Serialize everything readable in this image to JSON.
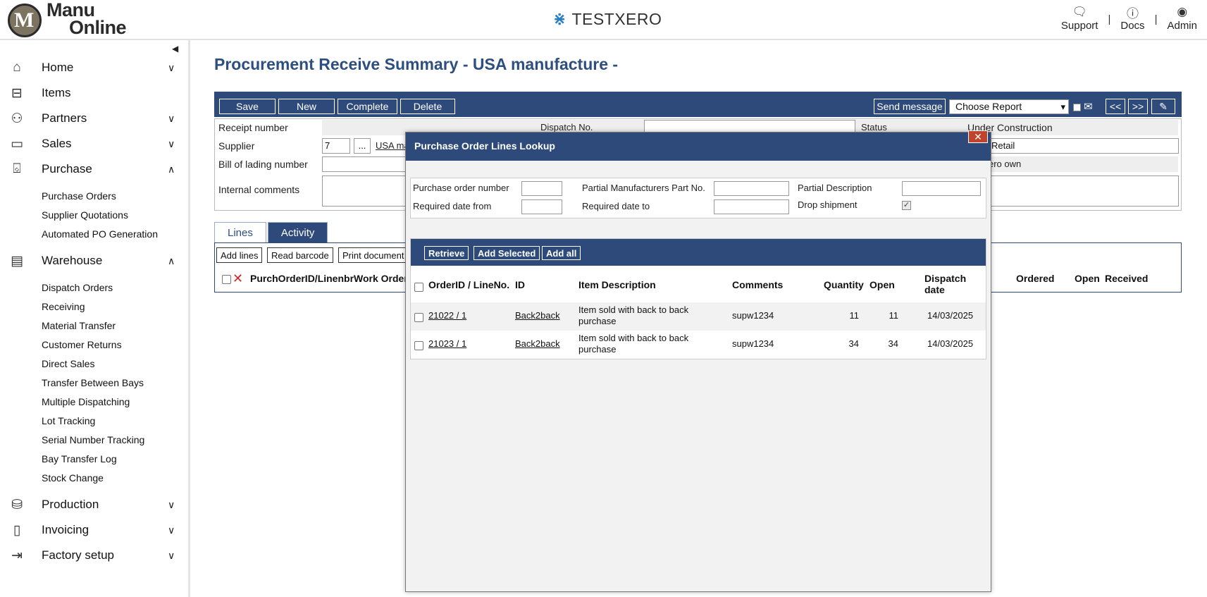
{
  "header": {
    "logo_line1": "Manu",
    "logo_line2": "Online",
    "brand": "TESTXERO",
    "links": [
      {
        "label": "Support",
        "icon": "chat-icon"
      },
      {
        "label": "Docs",
        "icon": "help-icon"
      },
      {
        "label": "Admin",
        "icon": "user-icon"
      }
    ],
    "separator": "|"
  },
  "sidebar": {
    "items": [
      {
        "label": "Home",
        "icon": "home-icon",
        "expanded": false
      },
      {
        "label": "Items",
        "icon": "items-icon"
      },
      {
        "label": "Partners",
        "icon": "partners-icon",
        "expanded": false
      },
      {
        "label": "Sales",
        "icon": "wallet-icon",
        "expanded": false
      },
      {
        "label": "Purchase",
        "icon": "basket-icon",
        "expanded": true
      },
      {
        "label": "Warehouse",
        "icon": "warehouse-icon",
        "expanded": true
      },
      {
        "label": "Production",
        "icon": "database-icon",
        "expanded": false
      },
      {
        "label": "Invoicing",
        "icon": "document-icon",
        "expanded": false
      },
      {
        "label": "Factory setup",
        "icon": "exit-icon",
        "expanded": false
      }
    ],
    "purchase_sub": [
      "Purchase Orders",
      "Supplier Quotations",
      "Automated PO Generation"
    ],
    "warehouse_sub": [
      "Dispatch Orders",
      "Receiving",
      "Material Transfer",
      "Customer Returns",
      "Direct Sales",
      "Transfer Between Bays",
      "Multiple Dispatching",
      "Lot Tracking",
      "Serial Number Tracking",
      "Bay Transfer Log",
      "Stock Change"
    ]
  },
  "page": {
    "title": "Procurement Receive Summary - USA manufacture -",
    "toolbar": {
      "save": "Save",
      "new": "New",
      "complete": "Complete",
      "delete": "Delete",
      "send_message": "Send message",
      "report": "Choose Report",
      "prev": "<<",
      "next": ">>",
      "attach": "✎"
    },
    "form": {
      "receipt_number_label": "Receipt number",
      "dispatch_no_label": "Dispatch No.",
      "status_label": "Status",
      "status_value": "Under Construction",
      "supplier_label": "Supplier",
      "supplier_id": "7",
      "supplier_browse": "...",
      "supplier_name": "USA ma",
      "retail_value": "Retail",
      "bill_label": "Bill of lading number",
      "own_value": "ero own",
      "internal_comments_label": "Internal comments"
    },
    "tabs": [
      "Lines",
      "Activity"
    ],
    "lines": {
      "buttons": [
        "Add lines",
        "Read barcode",
        "Print document"
      ],
      "headers": {
        "purch_order": "PurchOrderID/Linenbr",
        "work_order": "Work Order",
        "ordered": "Ordered",
        "open": "Open",
        "received": "Received"
      }
    }
  },
  "modal": {
    "title": "Purchase Order Lines Lookup",
    "close": "✕",
    "filters": {
      "po_number": "Purchase order number",
      "partial_mpn": "Partial Manufacturers Part No.",
      "partial_desc": "Partial Description",
      "req_from": "Required date from",
      "req_to": "Required date to",
      "drop_shipment": "Drop shipment",
      "drop_shipment_checked": true
    },
    "buttons": {
      "retrieve": "Retrieve",
      "add_selected": "Add Selected",
      "add_all": "Add all"
    },
    "columns": {
      "order_line": "OrderID / LineNo.",
      "id": "ID",
      "desc": "Item Description",
      "comments": "Comments",
      "quantity": "Quantity",
      "open": "Open",
      "dispatch_1": "Dispatch",
      "dispatch_2": "date"
    },
    "rows": [
      {
        "order_line": "21022 / 1",
        "id": "Back2back",
        "desc_1": "Item sold with back to back",
        "desc_2": "purchase",
        "comments": "supw1234",
        "quantity": "11",
        "open": "11",
        "dispatch": "14/03/2025"
      },
      {
        "order_line": "21023 / 1",
        "id": "Back2back",
        "desc_1": "Item sold with back to back",
        "desc_2": "purchase",
        "comments": "supw1234",
        "quantity": "34",
        "open": "34",
        "dispatch": "14/03/2025"
      }
    ]
  }
}
